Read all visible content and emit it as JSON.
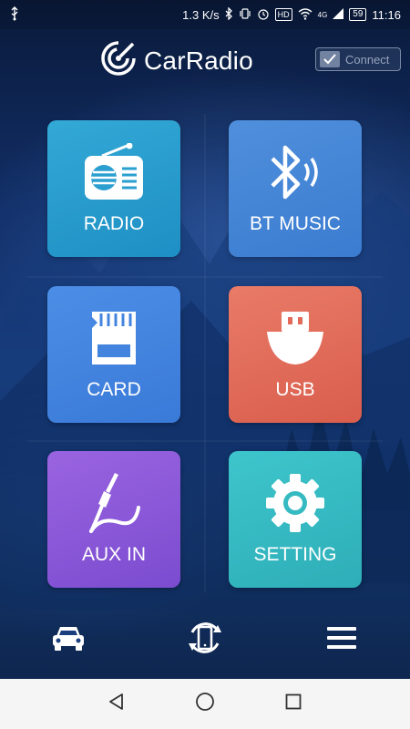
{
  "status_bar": {
    "speed": "1.3 K/s",
    "battery": "59",
    "time": "11:16",
    "hd_badge": "HD",
    "network": "4G"
  },
  "header": {
    "app_title": "CarRadio",
    "connect_label": "Connect"
  },
  "tiles": [
    {
      "label": "RADIO",
      "icon": "radio-icon"
    },
    {
      "label": "BT MUSIC",
      "icon": "bluetooth-music-icon"
    },
    {
      "label": "CARD",
      "icon": "sd-card-icon"
    },
    {
      "label": "USB",
      "icon": "usb-icon"
    },
    {
      "label": "AUX IN",
      "icon": "aux-cable-icon"
    },
    {
      "label": "SETTING",
      "icon": "gear-icon"
    }
  ],
  "toolbar": {
    "car": "car-icon",
    "phone_sync": "phone-sync-icon",
    "menu": "hamburger-menu-icon"
  },
  "nav": {
    "back": "back-icon",
    "home": "home-icon",
    "recents": "recents-icon"
  },
  "colors": {
    "radio": "#2a9fd0",
    "bt_music": "#4585d6",
    "card": "#4384df",
    "usb": "#e16a58",
    "aux_in": "#8a58d8",
    "setting": "#36bac2"
  }
}
